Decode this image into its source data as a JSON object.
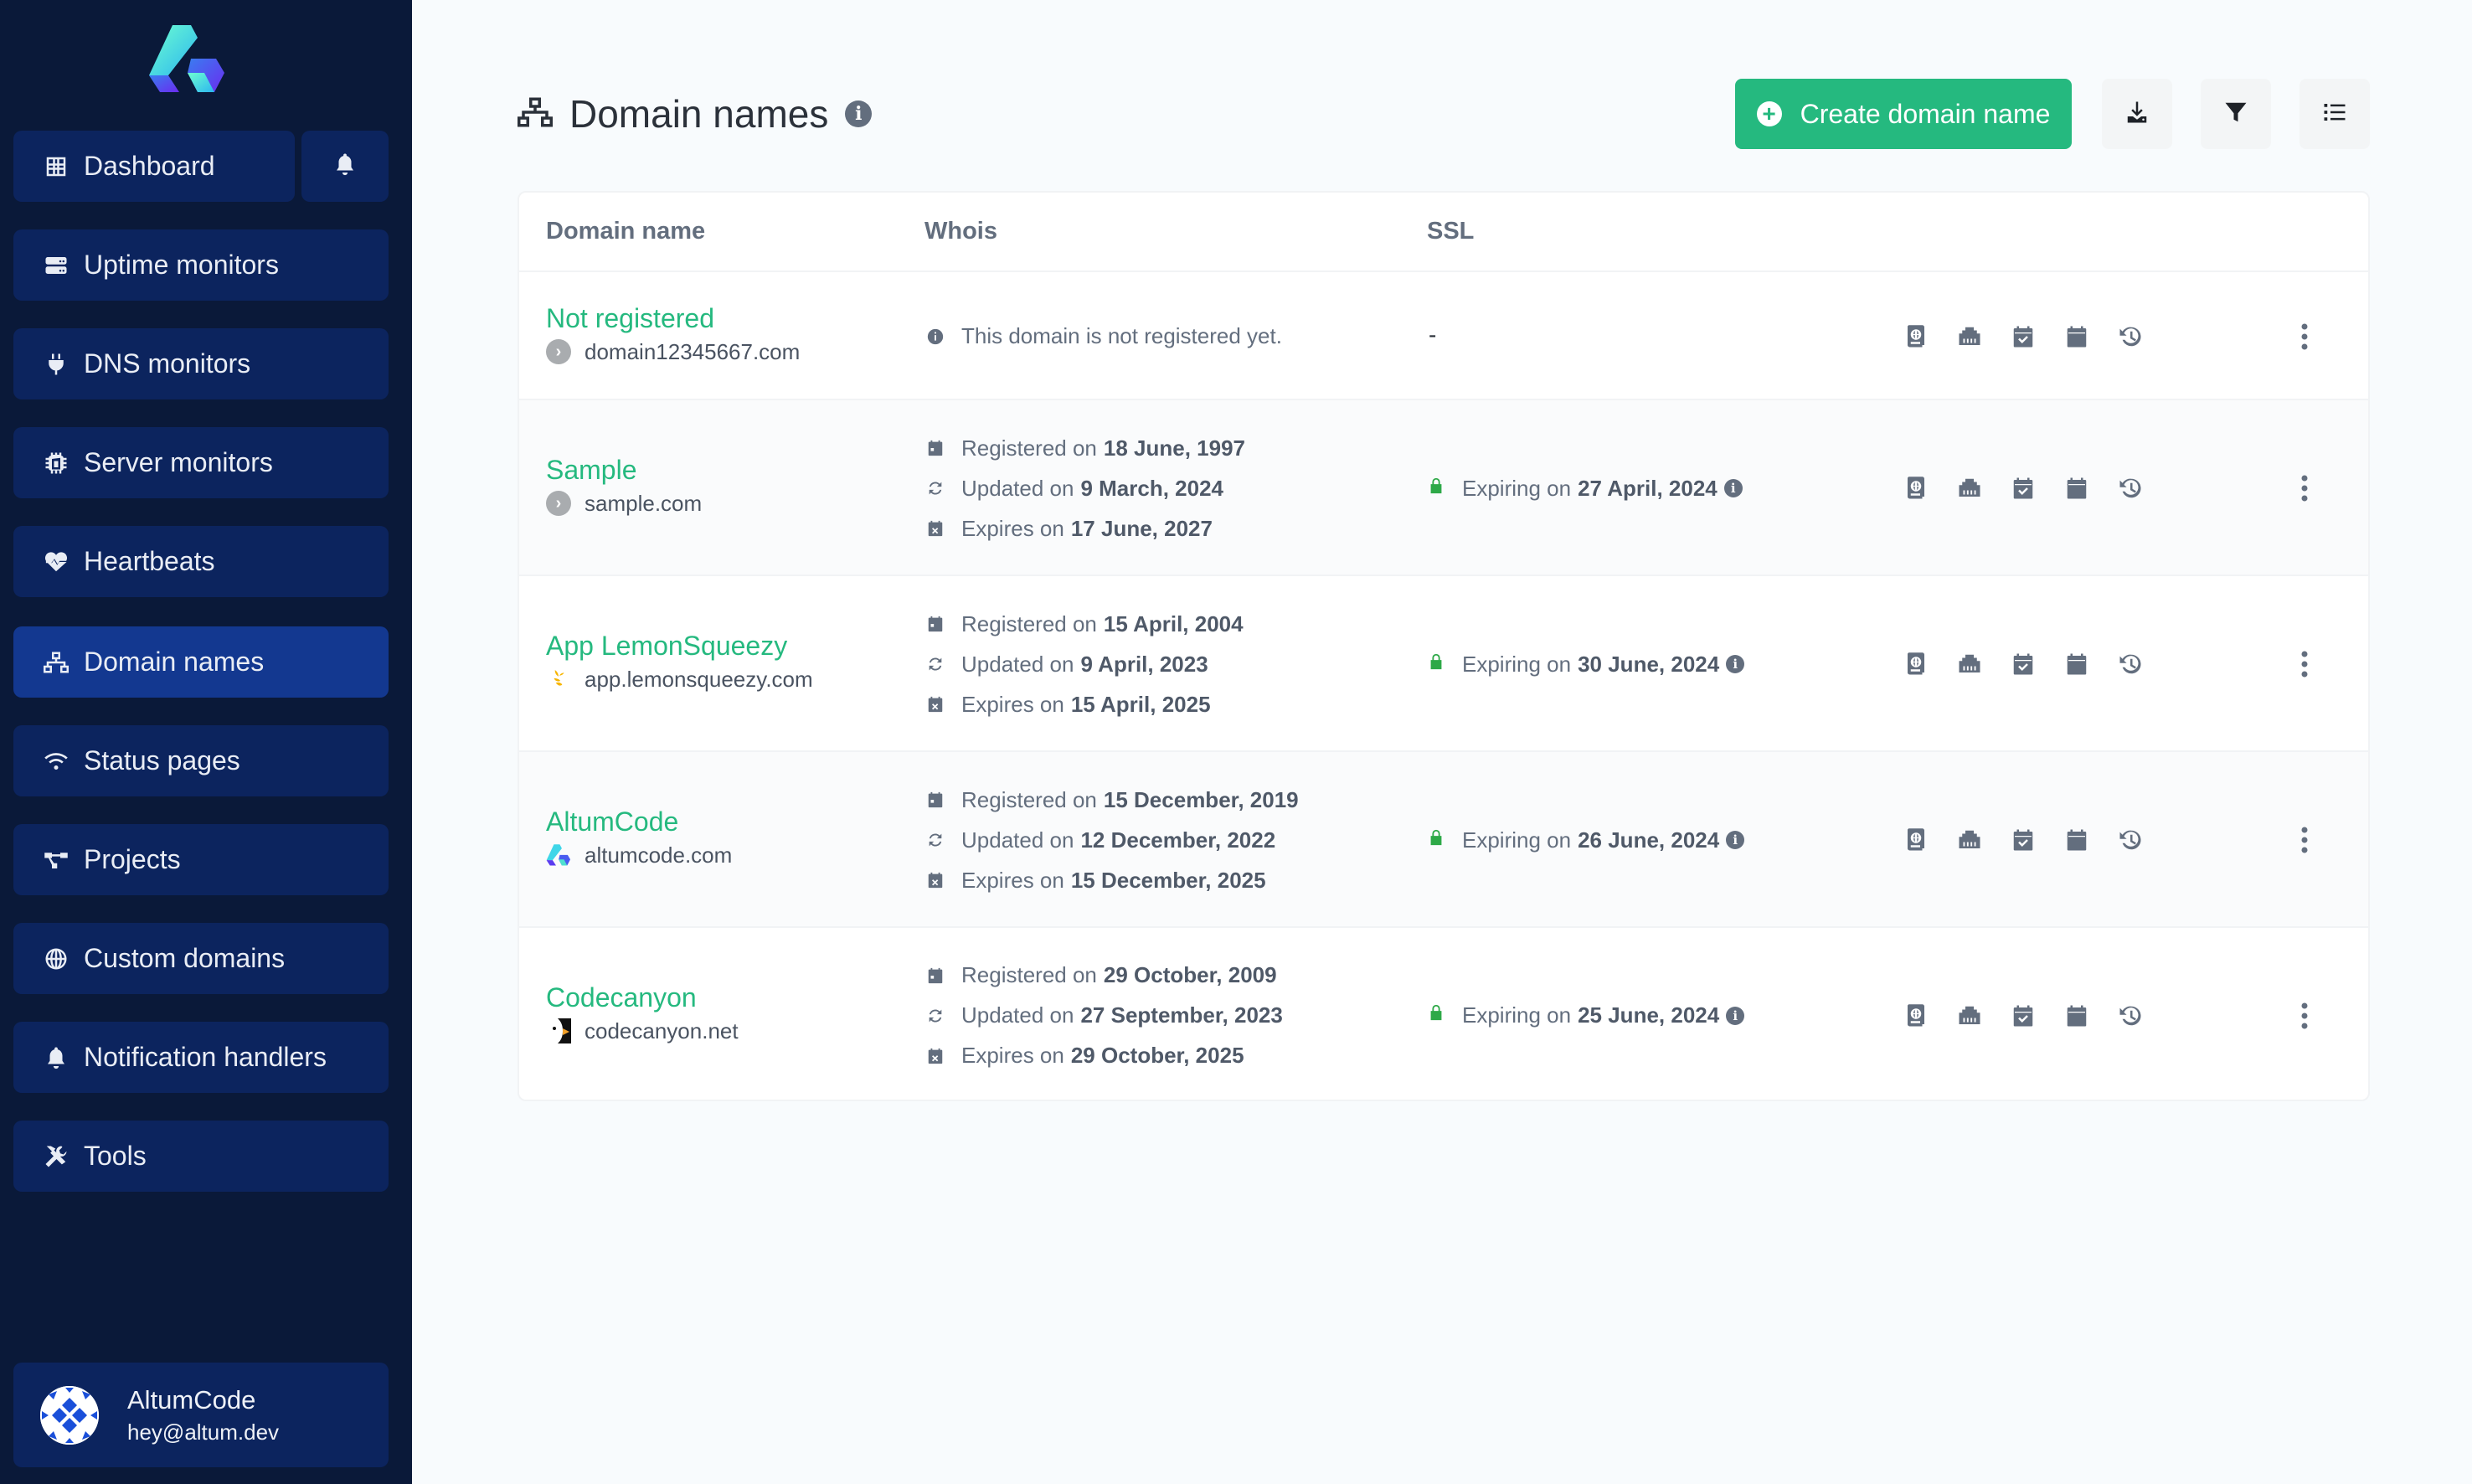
{
  "sidebar": {
    "logo_alt": "AltumCode logo",
    "items": [
      {
        "label": "Dashboard",
        "icon": "grid-icon",
        "active": false
      },
      {
        "label": "Uptime monitors",
        "icon": "server-icon",
        "active": false
      },
      {
        "label": "DNS monitors",
        "icon": "plug-icon",
        "active": false
      },
      {
        "label": "Server monitors",
        "icon": "microchip-icon",
        "active": false
      },
      {
        "label": "Heartbeats",
        "icon": "heart-pulse-icon",
        "active": false
      },
      {
        "label": "Domain names",
        "icon": "network-icon",
        "active": true
      },
      {
        "label": "Status pages",
        "icon": "wifi-icon",
        "active": false
      },
      {
        "label": "Projects",
        "icon": "project-diagram-icon",
        "active": false
      },
      {
        "label": "Custom domains",
        "icon": "globe-icon",
        "active": false
      },
      {
        "label": "Notification handlers",
        "icon": "bell-icon",
        "active": false
      },
      {
        "label": "Tools",
        "icon": "tools-icon",
        "active": false
      }
    ],
    "notifications_icon": "bell-icon",
    "user": {
      "name": "AltumCode",
      "email": "hey@altum.dev"
    }
  },
  "header": {
    "title": "Domain names",
    "title_icon": "network-icon",
    "info_icon": "info-circle-icon",
    "create_label": "Create domain name",
    "tools": [
      {
        "name": "download-button",
        "icon": "download-icon"
      },
      {
        "name": "filter-button",
        "icon": "filter-icon"
      },
      {
        "name": "list-view-button",
        "icon": "list-icon"
      }
    ]
  },
  "table": {
    "columns": [
      "Domain name",
      "Whois",
      "SSL"
    ],
    "labels": {
      "registered": "Registered on",
      "updated": "Updated on",
      "expires": "Expires on",
      "expiring": "Expiring on"
    },
    "rows": [
      {
        "name": "Not registered",
        "host": "domain12345667.com",
        "favicon": "default",
        "whois_message": "This domain is not registered yet.",
        "registered": null,
        "updated": null,
        "expires": null,
        "ssl": "-"
      },
      {
        "name": "Sample",
        "host": "sample.com",
        "favicon": "default",
        "registered": "18 June, 1997",
        "updated": "9 March, 2024",
        "expires": "17 June, 2027",
        "ssl_expiring": "27 April, 2024"
      },
      {
        "name": "App LemonSqueezy",
        "host": "app.lemonsqueezy.com",
        "favicon": "lemonsqueezy",
        "registered": "15 April, 2004",
        "updated": "9 April, 2023",
        "expires": "15 April, 2025",
        "ssl_expiring": "30 June, 2024"
      },
      {
        "name": "AltumCode",
        "host": "altumcode.com",
        "favicon": "altumcode",
        "registered": "15 December, 2019",
        "updated": "12 December, 2022",
        "expires": "15 December, 2025",
        "ssl_expiring": "26 June, 2024"
      },
      {
        "name": "Codecanyon",
        "host": "codecanyon.net",
        "favicon": "codecanyon",
        "registered": "29 October, 2009",
        "updated": "27 September, 2023",
        "expires": "29 October, 2025",
        "ssl_expiring": "25 June, 2024"
      }
    ],
    "row_actions": [
      "passport-icon",
      "ethernet-icon",
      "calendar-check-icon",
      "calendar-icon",
      "history-icon"
    ],
    "more_icon": "ellipsis-vertical-icon"
  },
  "colors": {
    "accent": "#25b97f",
    "sidebar_bg": "#0a1939",
    "sidebar_item": "#0c245e",
    "sidebar_active": "#133890",
    "ssl_ok": "#2ea948",
    "muted": "#636e7e"
  }
}
